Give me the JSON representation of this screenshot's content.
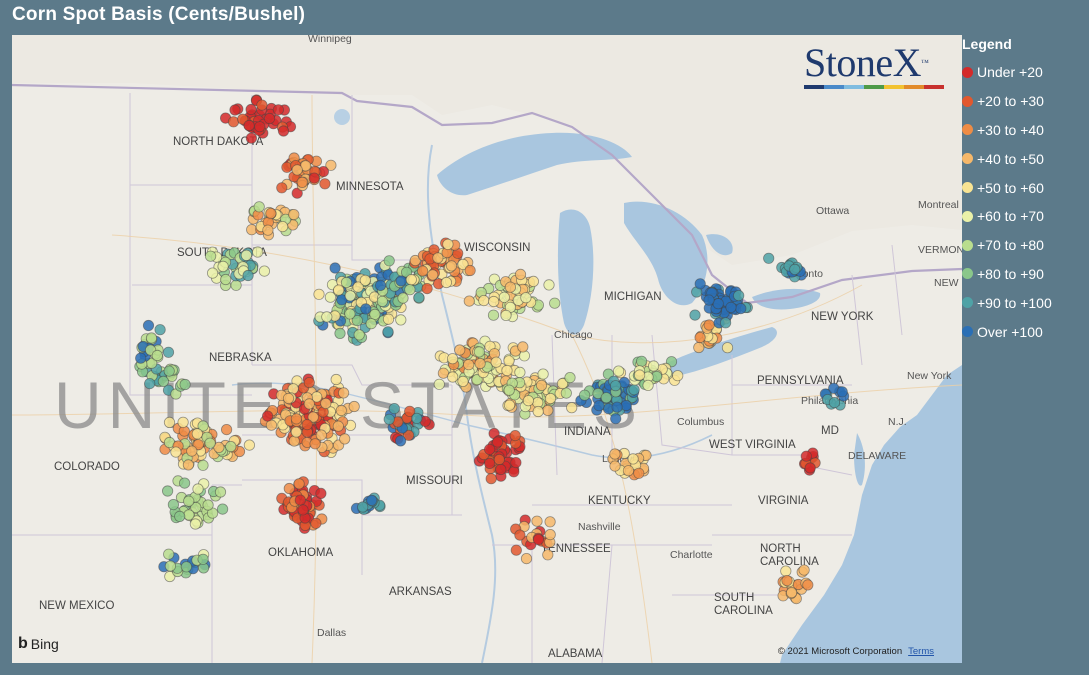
{
  "title": "Corn Spot Basis (Cents/Bushel)",
  "legend": {
    "title": "Legend",
    "items": [
      {
        "label": "Under +20",
        "color": "#d42a2a"
      },
      {
        "label": "+20 to +30",
        "color": "#e2582e"
      },
      {
        "label": "+30 to +40",
        "color": "#ee8c45"
      },
      {
        "label": "+40 to +50",
        "color": "#f6b86a"
      },
      {
        "label": "+50 to +60",
        "color": "#f9e493"
      },
      {
        "label": "+60 to +70",
        "color": "#eaf1a8"
      },
      {
        "label": "+70 to +80",
        "color": "#b9dd8e"
      },
      {
        "label": "+80 to +90",
        "color": "#8ac78a"
      },
      {
        "label": "+90 to +100",
        "color": "#4fa2a6"
      },
      {
        "label": "Over +100",
        "color": "#2a6fb5"
      }
    ]
  },
  "logo": {
    "text": "StoneX",
    "tm": "™"
  },
  "attribution": {
    "bing": "Bing",
    "copyright": "© 2021 Microsoft Corporation",
    "terms": "Terms"
  },
  "map_labels": {
    "winnipeg": "Winnipeg",
    "north_dakota": "NORTH DAKOTA",
    "minnesota": "MINNESOTA",
    "south_dakota": "SOUTH DAKOTA",
    "wisconsin": "WISCONSIN",
    "michigan": "MICHIGAN",
    "nebraska": "NEBRASKA",
    "united_states": "UNITED STATES",
    "colorado": "COLORADO",
    "missouri": "MISSOURI",
    "oklahoma": "OKLAHOMA",
    "new_mexico": "NEW MEXICO",
    "arkansas": "ARKANSAS",
    "dallas": "Dallas",
    "alabama": "ALABAMA",
    "tennessee": "TENNESSEE",
    "nashville": "Nashville",
    "kentucky": "KENTUCKY",
    "louisville": "Louisville",
    "indiana": "INDIANA",
    "chicago": "Chicago",
    "columbus": "Columbus",
    "west_virginia": "WEST VIRGINIA",
    "virginia": "VIRGINIA",
    "charlotte": "Charlotte",
    "north_carolina": "NORTH CAROLINA",
    "south_carolina": "SOUTH CAROLINA",
    "pennsylvania": "PENNSYLVANIA",
    "philadelphia": "Philadelphia",
    "md": "MD",
    "delaware": "DELAWARE",
    "nj": "N.J.",
    "new_york_state": "NEW YORK",
    "new_york_city": "New York",
    "ottawa": "Ottawa",
    "montreal": "Montreal",
    "vermont": "VERMONT",
    "new_hampshire": "NEW HAMP",
    "toronto": "Toronto"
  }
}
